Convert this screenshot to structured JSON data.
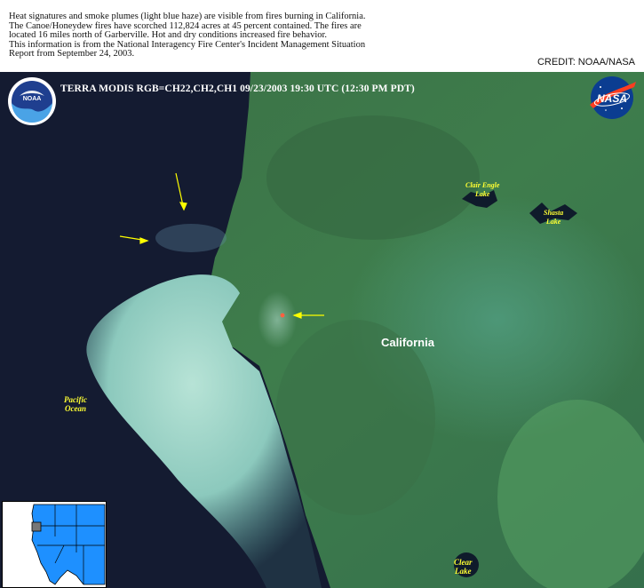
{
  "caption": {
    "line1": "Heat signatures and smoke plumes (light blue haze) are visible from fires burning in California.",
    "line2": "The Canoe/Honeydew fires have scorched 112,824 acres at 45 percent contained. The fires are",
    "line3": "located 16 miles north of Garberville. Hot and dry conditions increased fire behavior.",
    "line4": "This information is from the National Interagency Fire Center's Incident Management Situation",
    "line5": "Report from September 24, 2003."
  },
  "credit": "CREDIT: NOAA/NASA",
  "scene": {
    "title": "TERRA MODIS  RGB=CH22,CH2,CH1  09/23/2003  19:30 UTC (12:30 PM PDT)",
    "region_label": "California",
    "ocean_label_1": "Pacific",
    "ocean_label_2": "Ocean",
    "lakes": [
      {
        "line1": "Clair Engle",
        "line2": "Lake"
      },
      {
        "line1": "Shasta",
        "line2": "Lake"
      },
      {
        "line1": "Clear",
        "line2": "Lake"
      }
    ]
  },
  "logos": {
    "noaa": "NOAA",
    "nasa": "NASA"
  },
  "colors": {
    "land": "#3f7a48",
    "ocean": "#151d33",
    "plume": "#9fd4c8",
    "arrow": "#ffff00",
    "fire": "#ff6040",
    "inset_land": "#1e90ff"
  }
}
